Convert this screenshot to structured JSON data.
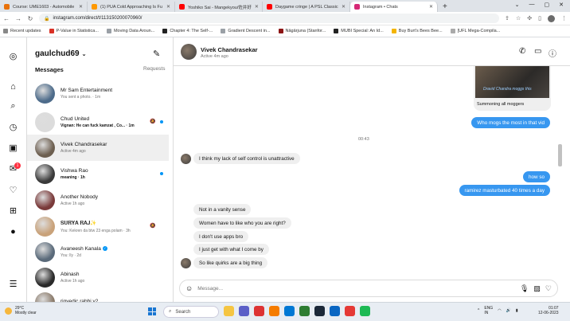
{
  "browser": {
    "tabs": [
      {
        "title": "Course: UME1603 - Automobile",
        "color": "#e8710a"
      },
      {
        "title": "(1) PUA Cold Approaching Is Fu",
        "color": "#ff9900"
      },
      {
        "title": "Yoshiko Sai - Mangekyou/佐井好",
        "color": "#ff0000"
      },
      {
        "title": "Daygame cringe | A PSL Classic",
        "color": "#ff0000"
      },
      {
        "title": "Instagram • Chats",
        "color": "#d62976"
      }
    ],
    "new_tab": "+",
    "url": "instagram.com/direct/t/113150200070960/",
    "bookmarks": [
      {
        "label": "Recent updates",
        "color": "#888"
      },
      {
        "label": "P-Value in Statistica...",
        "color": "#d93025"
      },
      {
        "label": "Moving Data Aroun...",
        "color": "#9aa0a6"
      },
      {
        "label": "Chapter 4: The Self-...",
        "color": "#222"
      },
      {
        "label": "Gradient Descent in...",
        "color": "#9aa0a6"
      },
      {
        "label": "Nāgārjuna (Stanfor...",
        "color": "#8c1515"
      },
      {
        "label": "MUBI Special: An Id...",
        "color": "#222"
      },
      {
        "label": "Buy Burt's Bees Bee...",
        "color": "#f4b400"
      },
      {
        "label": "[UFL Mega-Compila...",
        "color": "#aaa"
      }
    ]
  },
  "sidebar": {
    "username": "gaulchud69",
    "messages_label": "Messages",
    "requests_label": "Requests",
    "notification_badge": "1",
    "conversations": [
      {
        "name": "Mr Sam Entertainment",
        "preview": "You sent a photo. · 1m",
        "unread": false,
        "muted": false,
        "avatar_color": "#4d6b8a"
      },
      {
        "name": "Chud United",
        "preview": "Vignan: He can fuck kamzat , Co... · 1m",
        "unread": true,
        "muted": true,
        "avatar_color": "#dcdcdc"
      },
      {
        "name": "Vivek Chandrasekar",
        "preview": "Active 4m ago",
        "unread": false,
        "muted": false,
        "avatar_color": "#6d5f50"
      },
      {
        "name": "Vishwa Rao",
        "preview": "meaning · 1h",
        "unread": true,
        "muted": false,
        "avatar_color": "#3a3a3a"
      },
      {
        "name": "Another Nobody",
        "preview": "Active 1h ago",
        "unread": false,
        "muted": false,
        "avatar_color": "#7a3a3a"
      },
      {
        "name": "𝐒𝐔𝐑𝐘𝐀 𝐑𝐀𝐉✨",
        "preview": "You: Kekren da btw 23 enga polam · 3h",
        "unread": false,
        "muted": true,
        "avatar_color": "#c9a27a"
      },
      {
        "name": "Avaneesh Kanala",
        "preview": "You: lly · 2d",
        "unread": false,
        "muted": false,
        "avatar_color": "#5a6a7a"
      },
      {
        "name": "Abinash",
        "preview": "Active 1h ago",
        "unread": false,
        "muted": false,
        "avatar_color": "#2a2a2a"
      },
      {
        "name": "rigvedic.rabbi.v2",
        "preview": "",
        "unread": false,
        "muted": false,
        "avatar_color": "#8a7a6a"
      }
    ],
    "verified_mark": "✓"
  },
  "chat": {
    "contact_name": "Vivek Chandrasekar",
    "contact_status": "Active 4m ago",
    "shared_media_caption": "Summoning all moggers",
    "shared_media_overlay": "Dravid Chandra moggs this",
    "timestamp": "00:43",
    "messages_out_top": [
      "Who mogs the most in that vid"
    ],
    "message_in_1": "I think my lack of self control is unattractive",
    "messages_out_mid": [
      "how so",
      "ramirez masturbated 40 times a day"
    ],
    "messages_in_group": [
      "Not in a vanity sense",
      "Women have to like who you are right?",
      "I don't use apps bro",
      "I just get with what I come by",
      "So like quirks are a big thing"
    ],
    "composer_placeholder": "Message..."
  },
  "taskbar": {
    "temperature": "29°C",
    "weather": "Mostly clear",
    "search_label": "Search",
    "lang_top": "ENG",
    "lang_bottom": "IN",
    "time": "01:07",
    "date": "12-06-2023"
  }
}
